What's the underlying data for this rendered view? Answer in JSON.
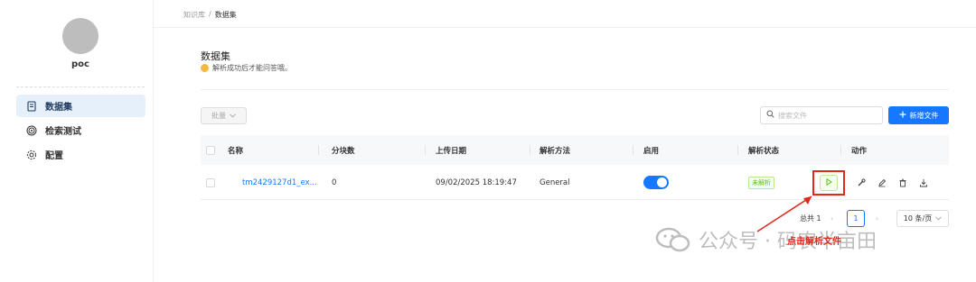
{
  "sidebar": {
    "username": "poc",
    "items": [
      {
        "label": "数据集",
        "icon": "document-icon",
        "active": true
      },
      {
        "label": "检索测试",
        "icon": "target-icon",
        "active": false
      },
      {
        "label": "配置",
        "icon": "gear-icon",
        "active": false
      }
    ]
  },
  "breadcrumb": [
    "知识库",
    "数据集"
  ],
  "page": {
    "title": "数据集",
    "hint": "解析成功后才能问答哦。"
  },
  "toolbar": {
    "bulk_label": "批量",
    "search_placeholder": "搜索文件",
    "add_label": "新增文件"
  },
  "table": {
    "columns": [
      "名称",
      "分块数",
      "上传日期",
      "解析方法",
      "启用",
      "解析状态",
      "动作"
    ],
    "rows": [
      {
        "name": "tm2429127d1_ex...",
        "chunks": "0",
        "upload_date": "09/02/2025 18:19:47",
        "parse_method": "General",
        "enabled": true,
        "status": "未解析"
      }
    ]
  },
  "pagination": {
    "total": "总共 1",
    "current_page": "1",
    "page_size": "10 条/页"
  },
  "annotation": "点击解析文件",
  "watermark": {
    "text": "公众号 · 码农半亩田"
  },
  "colors": {
    "accent": "#1677ff",
    "annotation": "#e0281c",
    "status_green": "#52c41a"
  }
}
